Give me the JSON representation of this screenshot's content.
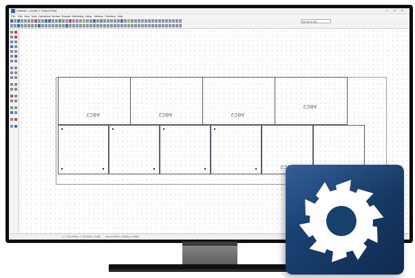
{
  "window": {
    "title": "Software - [Cutter 1 Output Plan]",
    "controls": [
      "–",
      "□",
      "×"
    ]
  },
  "menu": [
    "File",
    "Edit",
    "View",
    "Tools",
    "Operations",
    "Surface",
    "Toolpath",
    "Machining",
    "Setup",
    "Window",
    "Solutions",
    "Help"
  ],
  "toolbar": {
    "search_value": "[00.00,00.00]"
  },
  "canvas": {
    "part_label": "ABC2"
  },
  "status": {
    "left": "x: 7,701.0000 y: 7,791.0000 z: 0.000",
    "right": "Tool: 0.0000 x: 0.0000 y: 0.0000"
  },
  "logo": {
    "icon": "gear-saw-blade-icon",
    "color_top": "#1e4d8a",
    "color_bottom": "#0f2a4d"
  }
}
